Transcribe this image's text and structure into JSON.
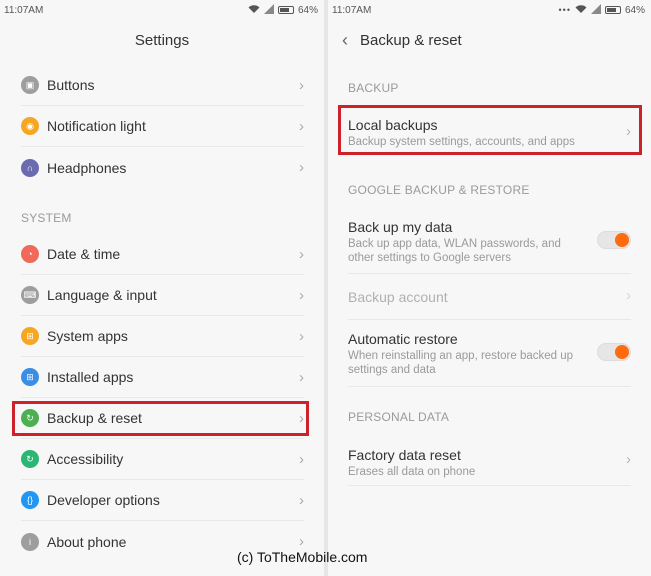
{
  "left": {
    "status": {
      "time": "11:07AM",
      "battery": "64%"
    },
    "title": "Settings",
    "items_top": [
      {
        "label": "Buttons",
        "icon": "buttons-icon",
        "color": "#9e9e9e"
      },
      {
        "label": "Notification light",
        "icon": "notification-light-icon",
        "color": "#f5a623"
      },
      {
        "label": "Headphones",
        "icon": "headphones-icon",
        "color": "#6b6bb0"
      }
    ],
    "section_system": "SYSTEM",
    "items_system": [
      {
        "label": "Date & time",
        "icon": "clock-icon",
        "color": "#ef6a5a"
      },
      {
        "label": "Language & input",
        "icon": "language-icon",
        "color": "#9e9e9e"
      },
      {
        "label": "System apps",
        "icon": "system-apps-icon",
        "color": "#f5a623"
      },
      {
        "label": "Installed apps",
        "icon": "installed-apps-icon",
        "color": "#3a8ee6"
      },
      {
        "label": "Backup & reset",
        "icon": "backup-icon",
        "color": "#4caf50"
      },
      {
        "label": "Accessibility",
        "icon": "accessibility-icon",
        "color": "#2bb673"
      },
      {
        "label": "Developer options",
        "icon": "developer-icon",
        "color": "#2196f3"
      },
      {
        "label": "About phone",
        "icon": "about-icon",
        "color": "#9e9e9e"
      }
    ]
  },
  "right": {
    "status": {
      "time": "11:07AM",
      "battery": "64%"
    },
    "title": "Backup & reset",
    "section_backup": "BACKUP",
    "local_backups": {
      "title": "Local backups",
      "subtitle": "Backup system settings, accounts, and apps"
    },
    "section_google": "GOOGLE BACKUP & RESTORE",
    "back_up_data": {
      "title": "Back up my data",
      "subtitle_1": "Back up app data, WLAN passwords, and",
      "subtitle_2": "other settings to Google servers",
      "enabled": true
    },
    "backup_account": {
      "title": "Backup account"
    },
    "auto_restore": {
      "title": "Automatic restore",
      "subtitle_1": "When reinstalling an app, restore backed up",
      "subtitle_2": "settings and data",
      "enabled": true
    },
    "section_personal": "PERSONAL DATA",
    "factory_reset": {
      "title": "Factory data reset",
      "subtitle": "Erases all data on phone"
    }
  },
  "caption": "(c) ToTheMobile.com",
  "colors": {
    "highlight": "#cc2228",
    "toggle_on": "#ff6b0f"
  }
}
